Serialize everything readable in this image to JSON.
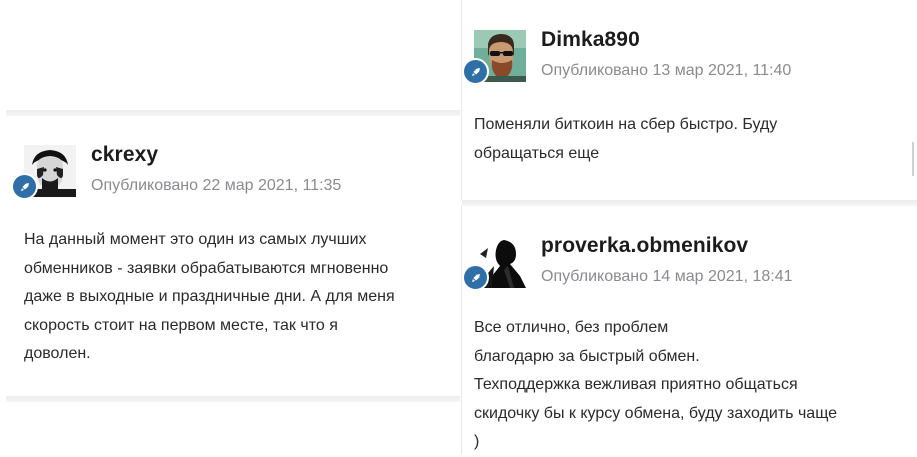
{
  "posts": [
    {
      "username": "ckrexy",
      "meta": "Опубликовано 22 мар 2021, 11:35",
      "avatar_icon": "portrait-avatar",
      "badge_icon": "rocket-icon",
      "lines": [
        "На данный момент это один из самых лучших",
        "обменников - заявки обрабатываются мгновенно",
        "даже в выходные и праздничные дни. А для меня",
        "скорость стоит на первом месте, так что я",
        "доволен."
      ]
    },
    {
      "username": "Dimka890",
      "meta": "Опубликовано 13 мар 2021, 11:40",
      "avatar_icon": "portrait-avatar",
      "badge_icon": "rocket-icon",
      "lines": [
        "Поменяли биткоин на сбер быстро. Буду",
        "обращаться еще"
      ]
    },
    {
      "username": "proverka.obmenikov",
      "meta": "Опубликовано 14 мар 2021, 18:41",
      "avatar_icon": "silhouette-avatar",
      "badge_icon": "rocket-icon",
      "lines": [
        "Все отлично, без проблем",
        "благодарю за быстрый обмен.",
        "Техподдержка вежливая приятно общаться",
        "скидочку бы к курсу обмена, буду заходить чаще",
        ")"
      ]
    }
  ],
  "colors": {
    "badge": "#2f6fa8",
    "meta": "#8b8b8f",
    "username": "#1c1c1c"
  }
}
